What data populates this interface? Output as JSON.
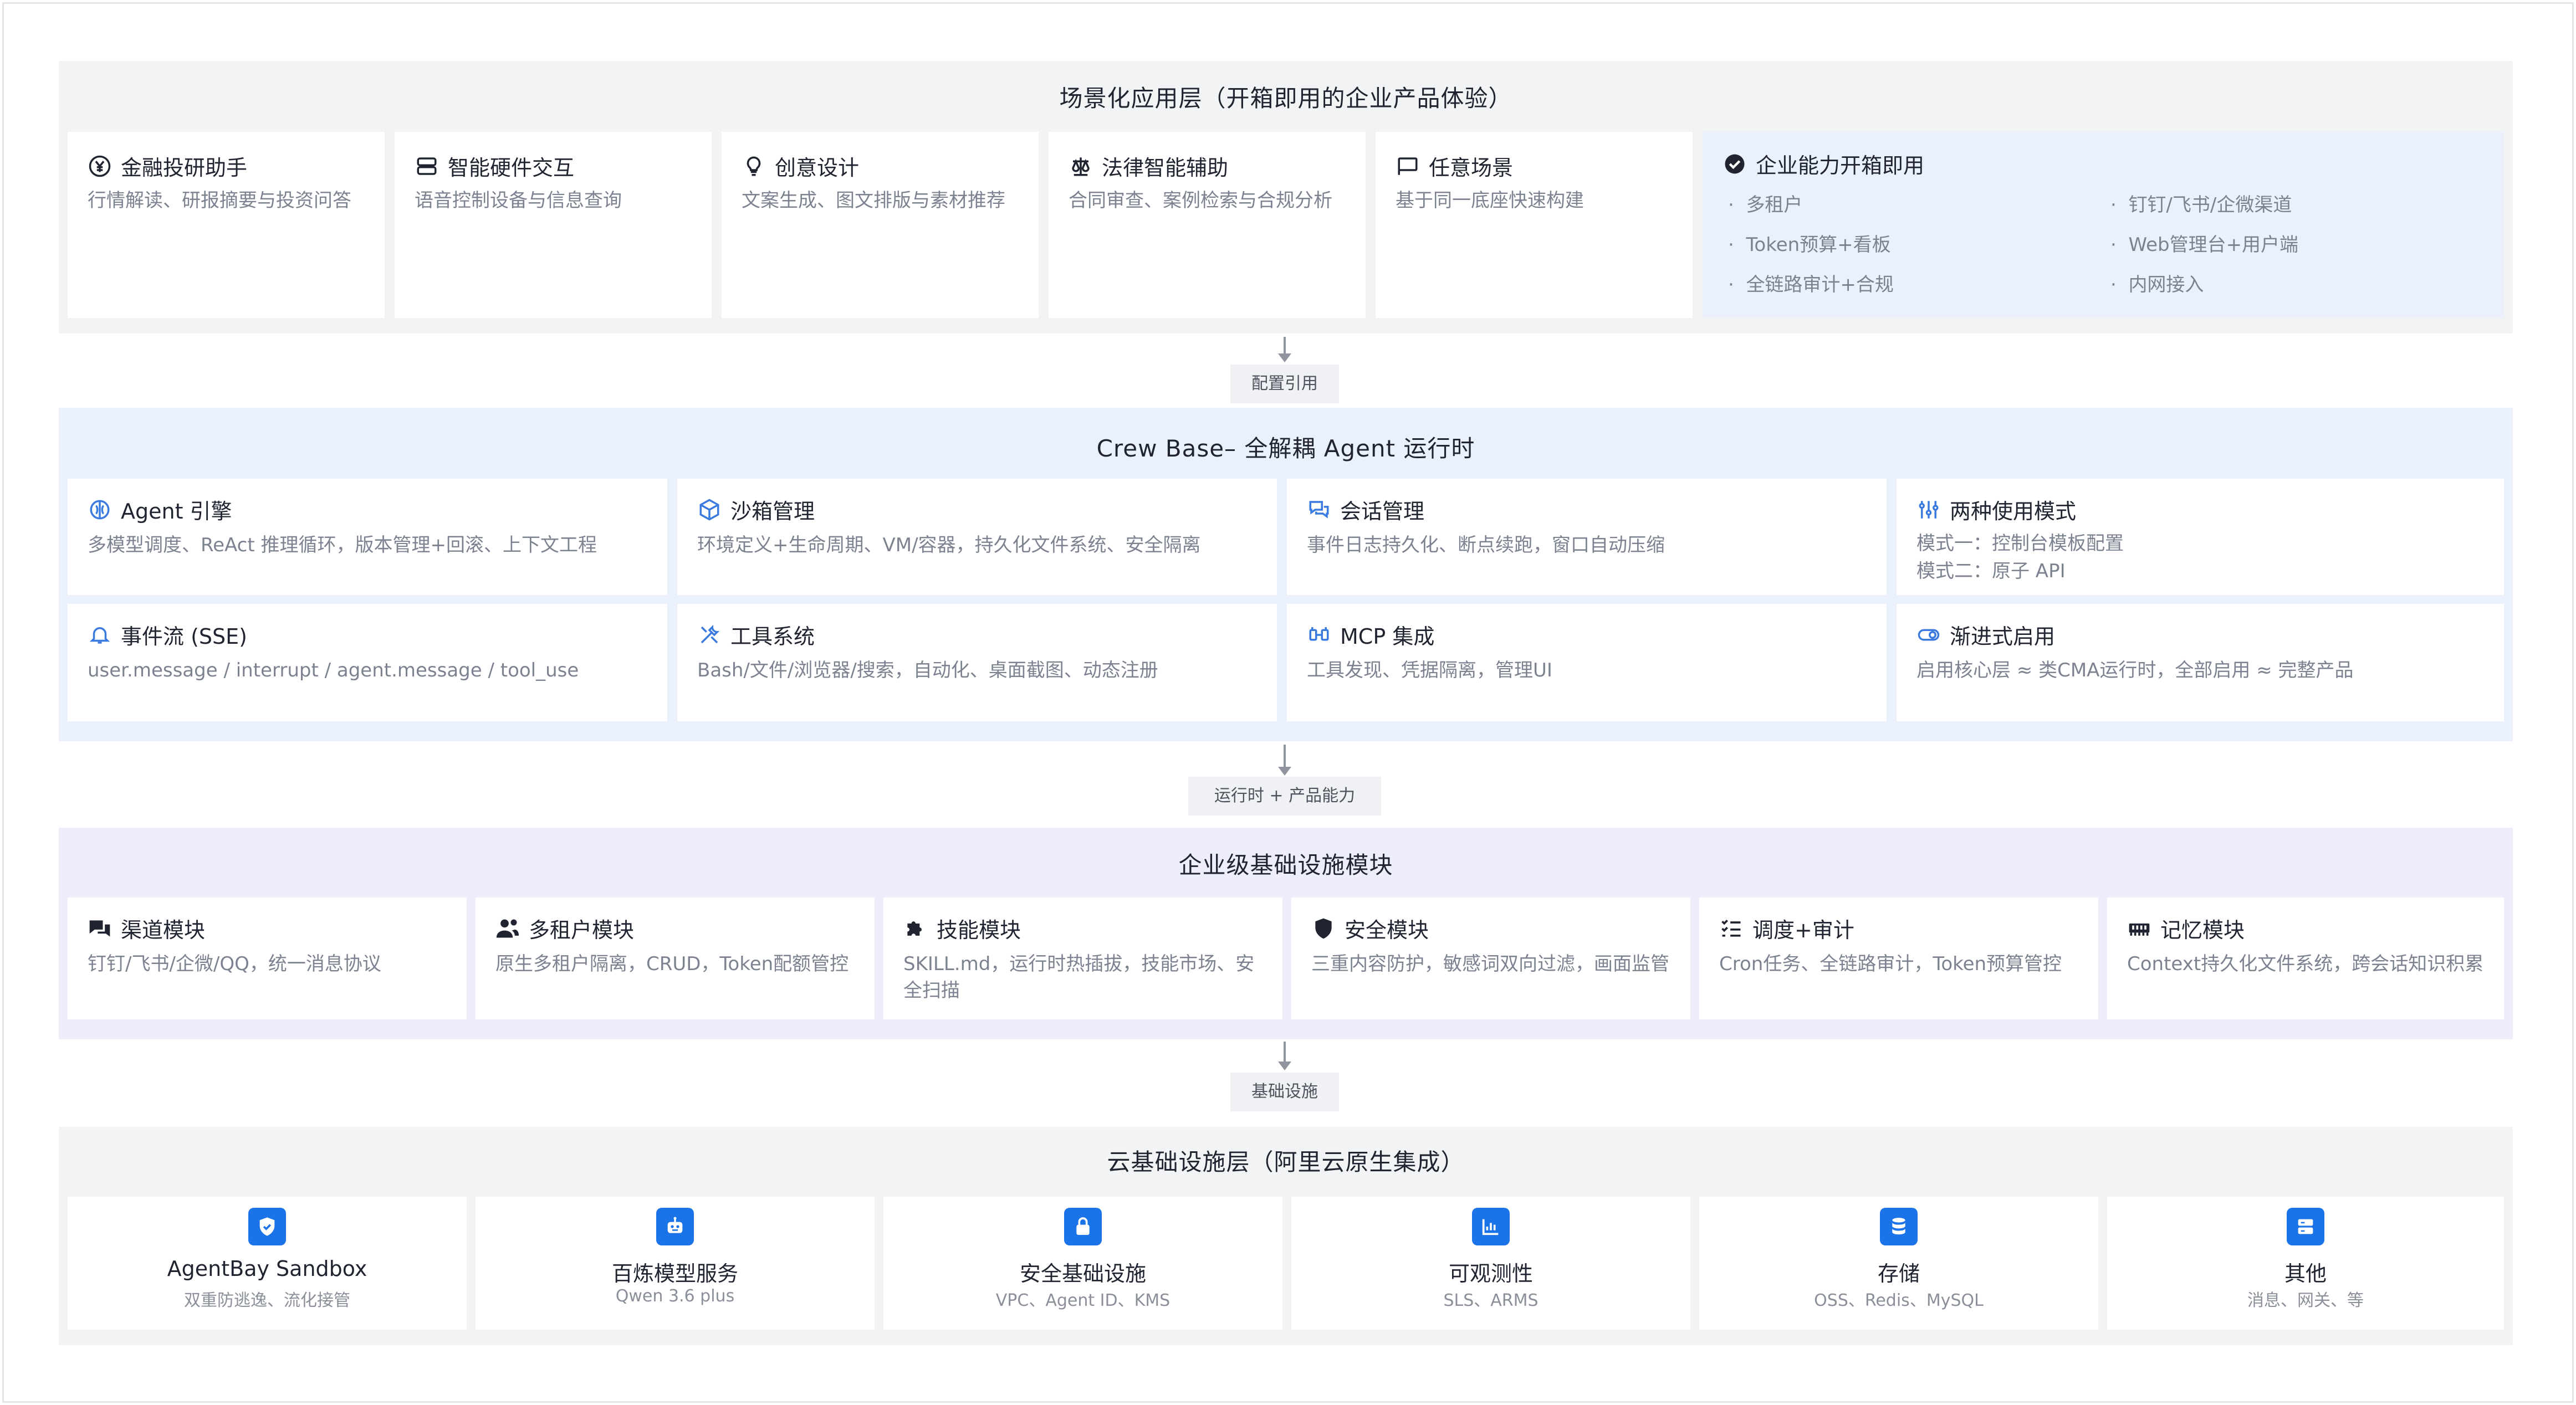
{
  "layers": {
    "scene": {
      "title": "场景化应用层（开箱即用的企业产品体验）",
      "cards": [
        {
          "title": "金融投研助手",
          "desc": "行情解读、研报摘要与投资问答",
          "icon": "yen-circle-icon"
        },
        {
          "title": "智能硬件交互",
          "desc": "语音控制设备与信息查询",
          "icon": "server-icon"
        },
        {
          "title": "创意设计",
          "desc": "文案生成、图文排版与素材推荐",
          "icon": "lightbulb-icon"
        },
        {
          "title": "法律智能辅助",
          "desc": "合同审查、案例检索与合规分析",
          "icon": "scale-icon"
        },
        {
          "title": "任意场景",
          "desc": "基于同一底座快速构建",
          "icon": "flag-icon"
        }
      ],
      "enterprise": {
        "title": "企业能力开箱即用",
        "icon": "check-circle-icon",
        "features_left": [
          "多租户",
          "Token预算+看板",
          "全链路审计+合规"
        ],
        "features_right": [
          "钉钉/飞书/企微渠道",
          "Web管理台+用户端",
          "内网接入"
        ]
      }
    },
    "crew": {
      "title": "Crew Base–  全解耦 Agent 运行时",
      "cards": [
        {
          "title": "Agent 引擎",
          "desc": "多模型调度、ReAct 推理循环，版本管理+回滚、上下文工程",
          "icon": "brain-icon"
        },
        {
          "title": "沙箱管理",
          "desc": "环境定义+生命周期、VM/容器，持久化文件系统、安全隔离",
          "icon": "cube-icon"
        },
        {
          "title": "会话管理",
          "desc": "事件日志持久化、断点续跑，窗口自动压缩",
          "icon": "chat-icon"
        },
        {
          "title": "两种使用模式",
          "desc_lines": [
            "模式一：控制台模板配置",
            "模式二：原子 API"
          ],
          "icon": "sliders-icon"
        },
        {
          "title": "事件流 (SSE)",
          "desc": "user.message / interrupt / agent.message / tool_use",
          "icon": "bell-icon"
        },
        {
          "title": "工具系统",
          "desc": "Bash/文件/浏览器/搜索，自动化、桌面截图、动态注册",
          "icon": "tools-icon"
        },
        {
          "title": "MCP 集成",
          "desc": "工具发现、凭据隔离，管理UI",
          "icon": "plug-icon"
        },
        {
          "title": "渐进式启用",
          "desc": "启用核心层 ≈ 类CMA运行时，全部启用 ≈ 完整产品",
          "icon": "toggle-icon"
        }
      ]
    },
    "enterprise_infra": {
      "title": "企业级基础设施模块",
      "cards": [
        {
          "title": "渠道模块",
          "desc": "钉钉/飞书/企微/QQ，统一消息协议",
          "icon": "comments-icon"
        },
        {
          "title": "多租户模块",
          "desc": "原生多租户隔离，CRUD，Token配额管控",
          "icon": "users-icon"
        },
        {
          "title": "技能模块",
          "desc": "SKILL.md，运行时热插拔，技能市场、安全扫描",
          "icon": "puzzle-icon"
        },
        {
          "title": "安全模块",
          "desc": "三重内容防护，敏感词双向过滤，画面监管",
          "icon": "shield-icon"
        },
        {
          "title": "调度+审计",
          "desc": "Cron任务、全链路审计，Token预算管控",
          "icon": "list-check-icon"
        },
        {
          "title": "记忆模块",
          "desc": "Context持久化文件系统，跨会话知识积累",
          "icon": "memory-icon"
        }
      ]
    },
    "cloud": {
      "title": "云基础设施层（阿里云原生集成）",
      "cards": [
        {
          "title": "AgentBay Sandbox",
          "sub": "双重防逃逸、流化接管",
          "icon": "shield-icon"
        },
        {
          "title": "百炼模型服务",
          "sub": "Qwen 3.6 plus",
          "icon": "robot-icon"
        },
        {
          "title": "安全基础设施",
          "sub": "VPC、Agent ID、KMS",
          "icon": "lock-icon"
        },
        {
          "title": "可观测性",
          "sub": "SLS、ARMS",
          "icon": "chart-icon"
        },
        {
          "title": "存储",
          "sub": "OSS、Redis、MySQL",
          "icon": "database-icon"
        },
        {
          "title": "其他",
          "sub": "消息、网关、等",
          "icon": "server-icon"
        }
      ]
    }
  },
  "connectors": {
    "c1": "配置引用",
    "c2": "运行时 + 产品能力",
    "c3": "基础设施"
  },
  "colors": {
    "scene_bg": "#f2f3f5",
    "crew_bg": "#eaf1fd",
    "infra_bg": "#eeedfb",
    "cloud_bg": "#f2f3f5",
    "enterprise_card_bg": "#eaf0fc",
    "accent_blue": "#1b73e8"
  }
}
